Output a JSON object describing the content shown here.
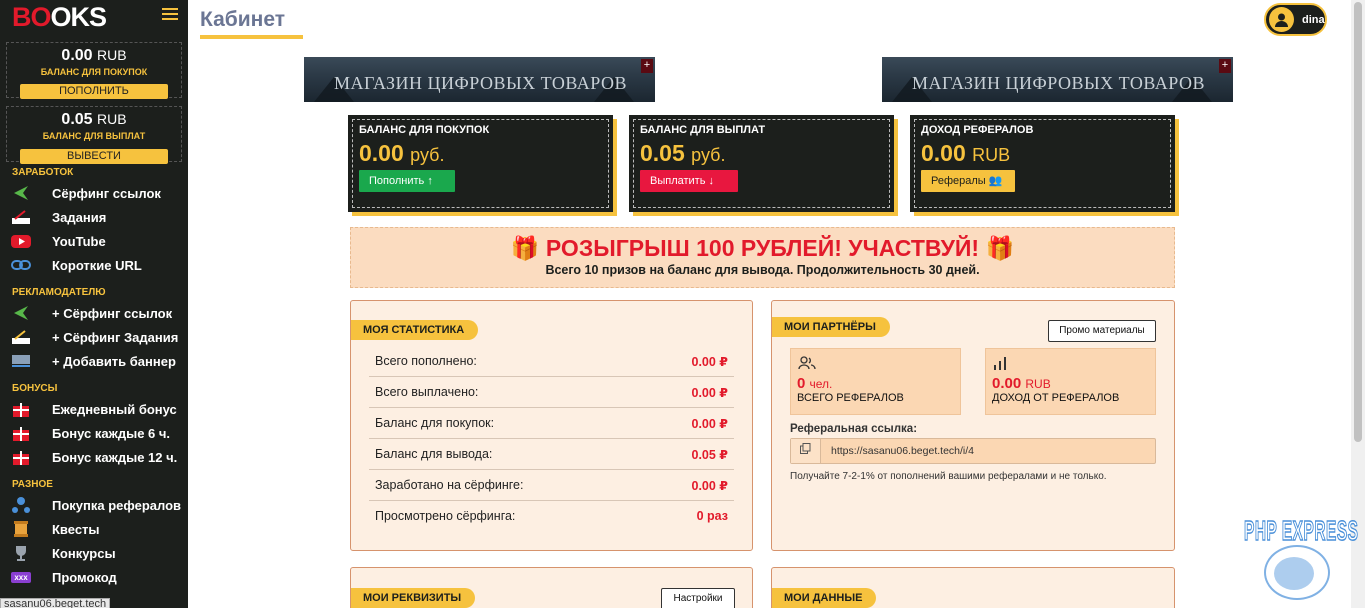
{
  "sidebar": {
    "logo_red": "BO",
    "logo_rest": "OKS",
    "buy_balance": {
      "amount": "0.00",
      "currency": "RUB",
      "label": "БАЛАНС ДЛЯ ПОКУПОК",
      "button": "ПОПОЛНИТЬ"
    },
    "pay_balance": {
      "amount": "0.05",
      "currency": "RUB",
      "label": "БАЛАНС ДЛЯ ВЫПЛАТ",
      "button": "ВЫВЕСТИ"
    },
    "sections": {
      "earn": "ЗАРАБОТОК",
      "advertiser": "РЕКЛАМОДАТЕЛЮ",
      "bonuses": "БОНУСЫ",
      "misc": "РАЗНОЕ"
    },
    "items": [
      {
        "label": "Сёрфинг ссылок",
        "icon": "arrow-left-icon"
      },
      {
        "label": "Задания",
        "icon": "book-pen-icon"
      },
      {
        "label": "YouTube",
        "icon": "youtube-icon"
      },
      {
        "label": "Короткие URL",
        "icon": "link-icon"
      },
      {
        "label": "+ Сёрфинг ссылок",
        "icon": "arrow-left-icon"
      },
      {
        "label": "+ Сёрфинг Задания",
        "icon": "book-pen-icon"
      },
      {
        "label": "+ Добавить баннер",
        "icon": "banner-icon"
      },
      {
        "label": "Ежедневный бонус",
        "icon": "gift-icon"
      },
      {
        "label": "Бонус каждые 6 ч.",
        "icon": "gift-icon"
      },
      {
        "label": "Бонус каждые 12 ч.",
        "icon": "gift-icon"
      },
      {
        "label": "Покупка рефералов",
        "icon": "network-icon"
      },
      {
        "label": "Квесты",
        "icon": "scroll-icon"
      },
      {
        "label": "Конкурсы",
        "icon": "trophy-icon"
      },
      {
        "label": "Промокод",
        "icon": "promo-icon",
        "icon_text": "xxx"
      }
    ],
    "status_url": "sasanu06.beget.tech"
  },
  "header": {
    "title": "Кабинет",
    "username": "dina"
  },
  "banners": [
    {
      "text": "МАГАЗИН ЦИФРОВЫХ ТОВАРОВ",
      "plus": "+"
    },
    {
      "text": "МАГАЗИН ЦИФРОВЫХ ТОВАРОВ",
      "plus": "+"
    }
  ],
  "cards": [
    {
      "label": "БАЛАНС ДЛЯ ПОКУПОК",
      "value": "0.00",
      "unit": "руб.",
      "button": "Пополнить ↑",
      "button_color": "#1aa84d"
    },
    {
      "label": "БАЛАНС ДЛЯ ВЫПЛАТ",
      "value": "0.05",
      "unit": "руб.",
      "button": "Выплатить ↓",
      "button_color": "#e8173f"
    },
    {
      "label": "ДОХОД РЕФЕРАЛОВ",
      "value": "0.00",
      "unit": "RUB",
      "button": "Рефералы 👥",
      "button_color": "#f6c23e"
    }
  ],
  "promo": {
    "title": "РОЗЫГРЫШ 100 РУБЛЕЙ! УЧАСТВУЙ!",
    "subtitle": "Всего 10 призов на баланс для вывода. Продолжительность 30 дней."
  },
  "stats": {
    "tag": "МОЯ СТАТИСТИКА",
    "rows": [
      {
        "label": "Всего пополнено:",
        "value": "0.00 ₽"
      },
      {
        "label": "Всего выплачено:",
        "value": "0.00 ₽"
      },
      {
        "label": "Баланс для покупок:",
        "value": "0.00 ₽"
      },
      {
        "label": "Баланс для вывода:",
        "value": "0.05 ₽"
      },
      {
        "label": "Заработано на сёрфинге:",
        "value": "0.00 ₽"
      },
      {
        "label": "Просмотрено сёрфинга:",
        "value": "0 раз"
      }
    ]
  },
  "partners": {
    "tag": "МОИ ПАРТНЁРЫ",
    "promo_button": "Промо материалы",
    "referrals": {
      "value": "0",
      "unit": "чел.",
      "label": "ВСЕГО РЕФЕРАЛОВ"
    },
    "income": {
      "value": "0.00",
      "unit": "RUB",
      "label": "ДОХОД ОТ РЕФЕРАЛОВ"
    },
    "ref_link_label": "Реферальная ссылка:",
    "ref_link": "https://sasanu06.beget.tech/i/4",
    "note": "Получайте 7-2-1% от пополнений вашими рефералами и не только."
  },
  "requisites": {
    "tag": "МОИ РЕКВИЗИТЫ",
    "button": "Настройки"
  },
  "mydata": {
    "tag": "МОИ ДАННЫЕ"
  },
  "watermark": "PHP EXPRESS",
  "colors": {
    "accent": "#f6c23e",
    "dark": "#1c1f1c",
    "red": "#e21a2b",
    "panel": "#fdefe2"
  }
}
